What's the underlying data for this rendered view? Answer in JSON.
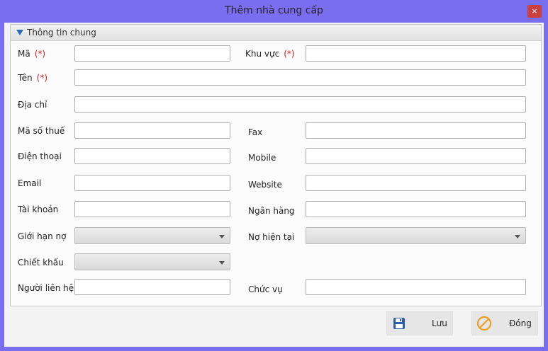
{
  "window": {
    "title": "Thêm nhà cung cấp",
    "close_label": "×"
  },
  "group": {
    "title": "Thông tin chung"
  },
  "required_mark": "(*)",
  "fields": {
    "ma": {
      "label": "Mã",
      "value": ""
    },
    "khu_vuc": {
      "label": "Khu vực",
      "value": ""
    },
    "ten": {
      "label": "Tên",
      "value": ""
    },
    "dia_chi": {
      "label": "Địa chỉ",
      "value": ""
    },
    "ma_so_thue": {
      "label": "Mã số thuế",
      "value": ""
    },
    "fax": {
      "label": "Fax",
      "value": ""
    },
    "dien_thoai": {
      "label": "Điện thoại",
      "value": ""
    },
    "mobile": {
      "label": "Mobile",
      "value": ""
    },
    "email": {
      "label": "Email",
      "value": ""
    },
    "website": {
      "label": "Website",
      "value": ""
    },
    "tai_khoan": {
      "label": "Tài khoản",
      "value": ""
    },
    "ngan_hang": {
      "label": "Ngân hàng",
      "value": ""
    },
    "gioi_han_no": {
      "label": "Giới hạn nợ",
      "value": ""
    },
    "no_hien_tai": {
      "label": "Nợ hiện tại",
      "value": ""
    },
    "chiet_khau": {
      "label": "Chiết khấu",
      "value": ""
    },
    "nguoi_lien_he": {
      "label": "Người liên hệ",
      "value": ""
    },
    "chuc_vu": {
      "label": "Chức vụ",
      "value": ""
    }
  },
  "buttons": {
    "save": {
      "label": "Lưu",
      "icon": "floppy-disk-icon"
    },
    "close": {
      "label": "Đóng",
      "icon": "cancel-circle-icon"
    }
  },
  "colors": {
    "title_bar": "#7a6ef0",
    "required": "#d02020",
    "save_icon": "#2a5fb0",
    "close_icon": "#e8a020"
  }
}
